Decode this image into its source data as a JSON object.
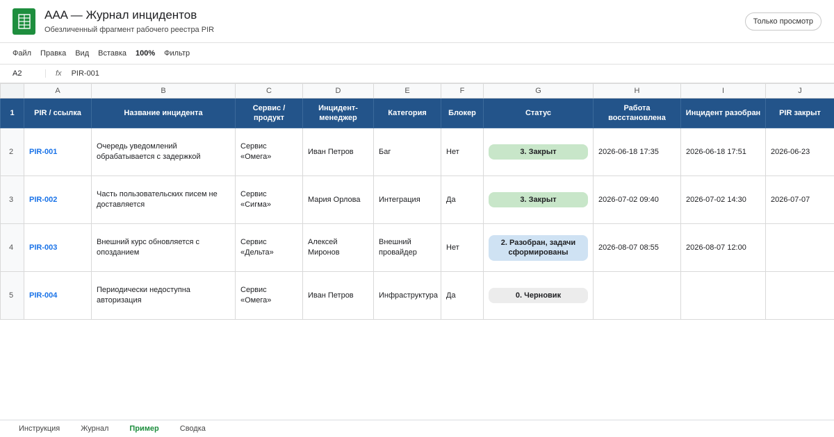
{
  "app": {
    "title": "AAA — Журнал инцидентов",
    "subtitle": "Обезличенный фрагмент рабочего реестра PIR",
    "view_only_label": "Только просмотр",
    "logo_icon": "spreadsheet-icon",
    "brand_color": "#1e8e3e"
  },
  "menu": {
    "file": "Файл",
    "edit": "Правка",
    "view": "Вид",
    "insert": "Вставка",
    "zoom": "100%",
    "filter": "Фильтр"
  },
  "formula_bar": {
    "cell_ref": "A2",
    "fx": "fx",
    "value": "PIR-001"
  },
  "columns": [
    "A",
    "B",
    "C",
    "D",
    "E",
    "F",
    "G",
    "H",
    "I",
    "J"
  ],
  "header_row": {
    "row_number": "1",
    "cells": [
      "PIR / ссылка",
      "Название инцидента",
      "Сервис / продукт",
      "Инцидент-менеджер",
      "Категория",
      "Блокер",
      "Статус",
      "Работа восстановлена",
      "Инцидент разобран",
      "PIR закрыт"
    ],
    "color": "#23548a"
  },
  "rows": [
    {
      "row_number": "2",
      "pir": "PIR-001",
      "title": "Очередь уведомлений обрабатывается с задержкой",
      "service": "Сервис «Омега»",
      "manager": "Иван Петров",
      "category": "Баг",
      "blocker": "Нет",
      "status": "3. Закрыт",
      "restored": "2026-06-18 17:35",
      "analyzed": "2026-06-18 17:51",
      "closed": "2026-06-23"
    },
    {
      "row_number": "3",
      "pir": "PIR-002",
      "title": "Часть пользовательских писем не доставляется",
      "service": "Сервис «Сигма»",
      "manager": "Мария Орлова",
      "category": "Интеграция",
      "blocker": "Да",
      "status": "3. Закрыт",
      "restored": "2026-07-02 09:40",
      "analyzed": "2026-07-02 14:30",
      "closed": "2026-07-07"
    },
    {
      "row_number": "4",
      "pir": "PIR-003",
      "title": "Внешний курс обновляется с опозданием",
      "service": "Сервис «Дельта»",
      "manager": "Алексей Миронов",
      "category": "Внешний провайдер",
      "blocker": "Нет",
      "status": "2. Разобран, задачи сформированы",
      "restored": "2026-08-07 08:55",
      "analyzed": "2026-08-07 12:00",
      "closed": ""
    },
    {
      "row_number": "5",
      "pir": "PIR-004",
      "title": "Периодически недоступна авторизация",
      "service": "Сервис «Омега»",
      "manager": "Иван Петров",
      "category": "Инфраструктура",
      "blocker": "Да",
      "status": "0. Черновик",
      "restored": "",
      "analyzed": "",
      "closed": ""
    }
  ],
  "status_colors": {
    "closed": "#c8e6c9",
    "analyzed": "#cfe2f3",
    "draft": "#ececec"
  },
  "tabs": {
    "instruction": "Инструкция",
    "journal": "Журнал",
    "example": "Пример",
    "summary": "Сводка",
    "active": "Пример"
  }
}
